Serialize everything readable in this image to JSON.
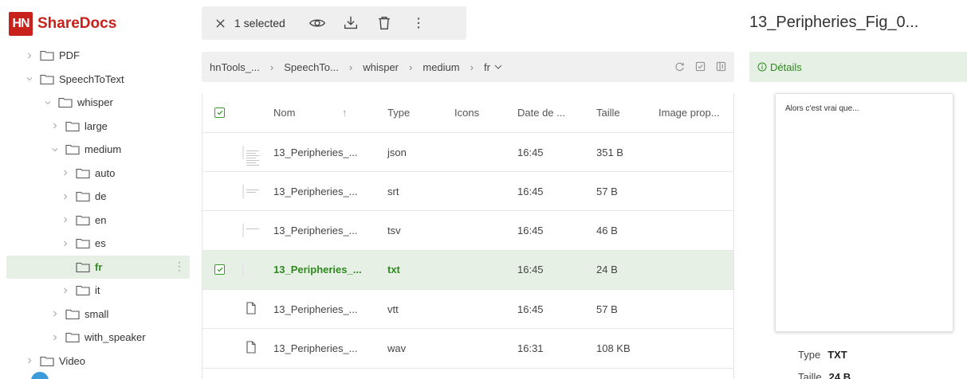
{
  "app": {
    "logo_text": "HN",
    "name": "ShareDocs"
  },
  "colors": {
    "brand": "#c8201a",
    "accent": "#2e8a1f",
    "selected_bg": "#e7f0e5"
  },
  "sidebar": {
    "tree": [
      {
        "label": "PDF",
        "level": 1,
        "expanded": false
      },
      {
        "label": "SpeechToText",
        "level": 1,
        "expanded": true
      },
      {
        "label": "whisper",
        "level": 2,
        "expanded": true
      },
      {
        "label": "large",
        "level": 3,
        "expanded": false
      },
      {
        "label": "medium",
        "level": 3,
        "expanded": true
      },
      {
        "label": "auto",
        "level": 4,
        "expanded": false
      },
      {
        "label": "de",
        "level": 4,
        "expanded": false
      },
      {
        "label": "en",
        "level": 4,
        "expanded": false
      },
      {
        "label": "es",
        "level": 4,
        "expanded": false
      },
      {
        "label": "fr",
        "level": 4,
        "expanded": false,
        "selected": true
      },
      {
        "label": "it",
        "level": 4,
        "expanded": false
      },
      {
        "label": "small",
        "level": 3,
        "expanded": false
      },
      {
        "label": "with_speaker",
        "level": 3,
        "expanded": false
      },
      {
        "label": "Video",
        "level": 1,
        "expanded": false
      }
    ]
  },
  "toolbar": {
    "selection_label": "1 selected",
    "icons": [
      "close-icon",
      "eye-icon",
      "download-icon",
      "trash-icon",
      "more-vertical-icon"
    ]
  },
  "breadcrumb": {
    "items": [
      "hnTools_...",
      "SpeechTo...",
      "whisper",
      "medium",
      "fr"
    ]
  },
  "table": {
    "columns": {
      "name": "Nom",
      "type": "Type",
      "icons": "Icons",
      "date": "Date de ...",
      "size": "Taille",
      "image": "Image prop..."
    },
    "rows": [
      {
        "name": "13_Peripheries_...",
        "type": "json",
        "date": "16:45",
        "size": "351 B",
        "thumb": "document",
        "selected": false
      },
      {
        "name": "13_Peripheries_...",
        "type": "srt",
        "date": "16:45",
        "size": "57 B",
        "thumb": "document",
        "selected": false
      },
      {
        "name": "13_Peripheries_...",
        "type": "tsv",
        "date": "16:45",
        "size": "46 B",
        "thumb": "document",
        "selected": false
      },
      {
        "name": "13_Peripheries_...",
        "type": "txt",
        "date": "16:45",
        "size": "24 B",
        "thumb": "document",
        "selected": true
      },
      {
        "name": "13_Peripheries_...",
        "type": "vtt",
        "date": "16:45",
        "size": "57 B",
        "thumb": "file-icon",
        "selected": false
      },
      {
        "name": "13_Peripheries_...",
        "type": "wav",
        "date": "16:31",
        "size": "108 KB",
        "thumb": "file-icon",
        "selected": false
      }
    ]
  },
  "details": {
    "title": "13_Peripheries_Fig_0...",
    "tab_label": "Détails",
    "preview_text": "Alors c'est vrai que...",
    "type_label": "Type",
    "type_value": "TXT",
    "size_label": "Taille",
    "size_value": "24 B"
  }
}
